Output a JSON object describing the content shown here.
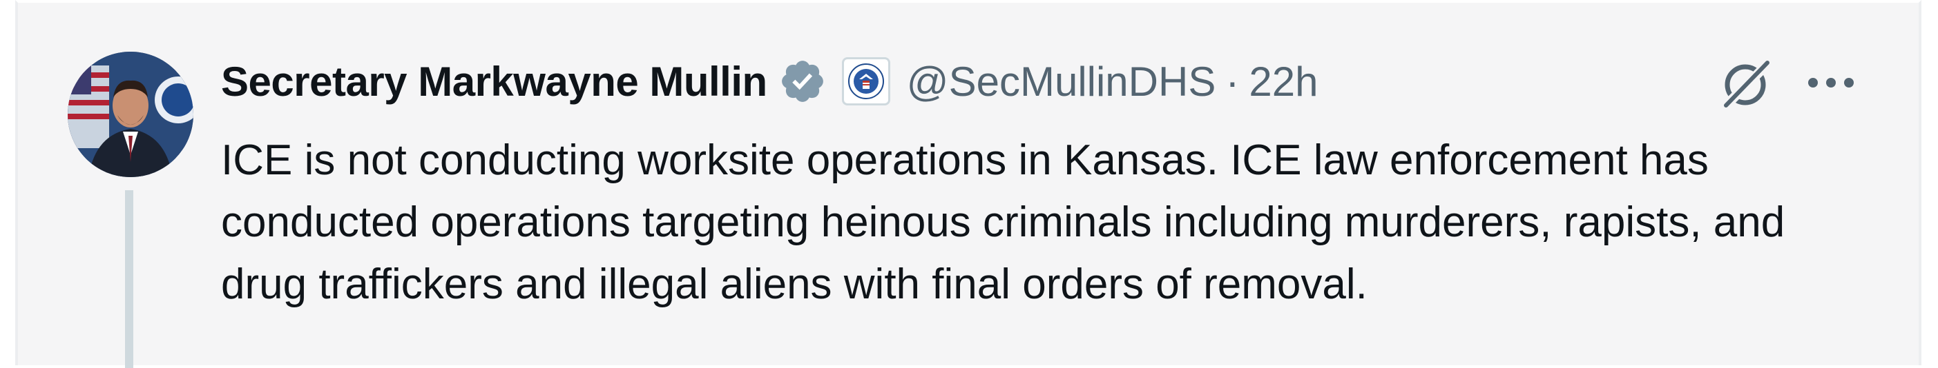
{
  "tweet": {
    "author": {
      "display_name": "Secretary Markwayne Mullin",
      "handle": "@SecMullinDHS",
      "verified_badge": "verified-check-icon",
      "affiliation_badge": "dhs-seal-icon"
    },
    "separator": "·",
    "timestamp": "22h",
    "text": "ICE is not conducting worksite operations in Kansas. ICE law enforcement has conducted operations targeting heinous criminals including murderers, rapists, and drug traffickers and illegal aliens with final orders of removal.",
    "actions": {
      "grok_icon": "grok-icon",
      "more_icon": "more-icon"
    }
  },
  "colors": {
    "background": "#f5f5f6",
    "primary_text": "#0f1419",
    "secondary_text": "#536471",
    "thread_line": "#cfd9de",
    "verified_badge": "#829aab"
  }
}
